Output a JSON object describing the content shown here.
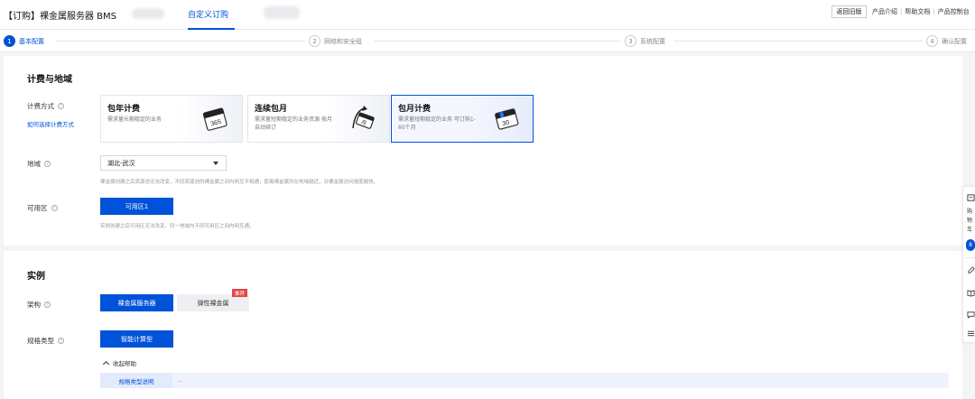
{
  "header": {
    "title": "【订购】裸金属服务器 BMS",
    "active_tab": "自定义订购",
    "old_version_button": "返回旧版",
    "links": [
      "产品介绍",
      "帮助文档",
      "产品控制台"
    ]
  },
  "steps": [
    {
      "num": "1",
      "label": "基本配置",
      "active": true
    },
    {
      "num": "2",
      "label": "网络和安全组",
      "active": false
    },
    {
      "num": "3",
      "label": "系统配置",
      "active": false
    },
    {
      "num": "4",
      "label": "确认配置",
      "active": false
    }
  ],
  "billing_section": {
    "title": "计费与地域",
    "billing_label": "计费方式",
    "billing_help_link": "如何选择计费方式",
    "cards": [
      {
        "title": "包年计费",
        "desc": "需求量长期稳定的业务",
        "illus_number": "365",
        "selected": false
      },
      {
        "title": "连续包月",
        "desc": "需求量短期稳定的业务资源 按月自动续订",
        "illus_number": "月",
        "selected": false
      },
      {
        "title": "包月计费",
        "desc": "需求量短期稳定的业务 可订购1-60个月",
        "illus_number": "30",
        "selected": true
      }
    ],
    "region_label": "地域",
    "region_value": "湖北-武汉",
    "region_hint": "裸金属创建之后资源池无法改变，不同资源池的裸金属之间内网互不相通；距离裸金属所在地域越近，对裸金属访问速度越快。",
    "zone_label": "可用区",
    "zone_button": "可用区1",
    "zone_hint": "实例创建之后可用区无法改变，同一地域内不同可用区之间内网互通。"
  },
  "instance_section": {
    "title": "实例",
    "arch_label": "架构",
    "arch_options": [
      "裸金属服务器",
      "弹性裸金属"
    ],
    "arch_badge": "推荐",
    "spec_label": "规格类型",
    "spec_button": "智能计算型",
    "collapse_label": "收起帮助",
    "help_key": "规格类型说明",
    "help_value": "--"
  },
  "side_toolbar": {
    "chars": [
      "购",
      "物",
      "车"
    ],
    "count": "8"
  },
  "colors": {
    "primary": "#0052d9",
    "badge": "#e54545"
  }
}
